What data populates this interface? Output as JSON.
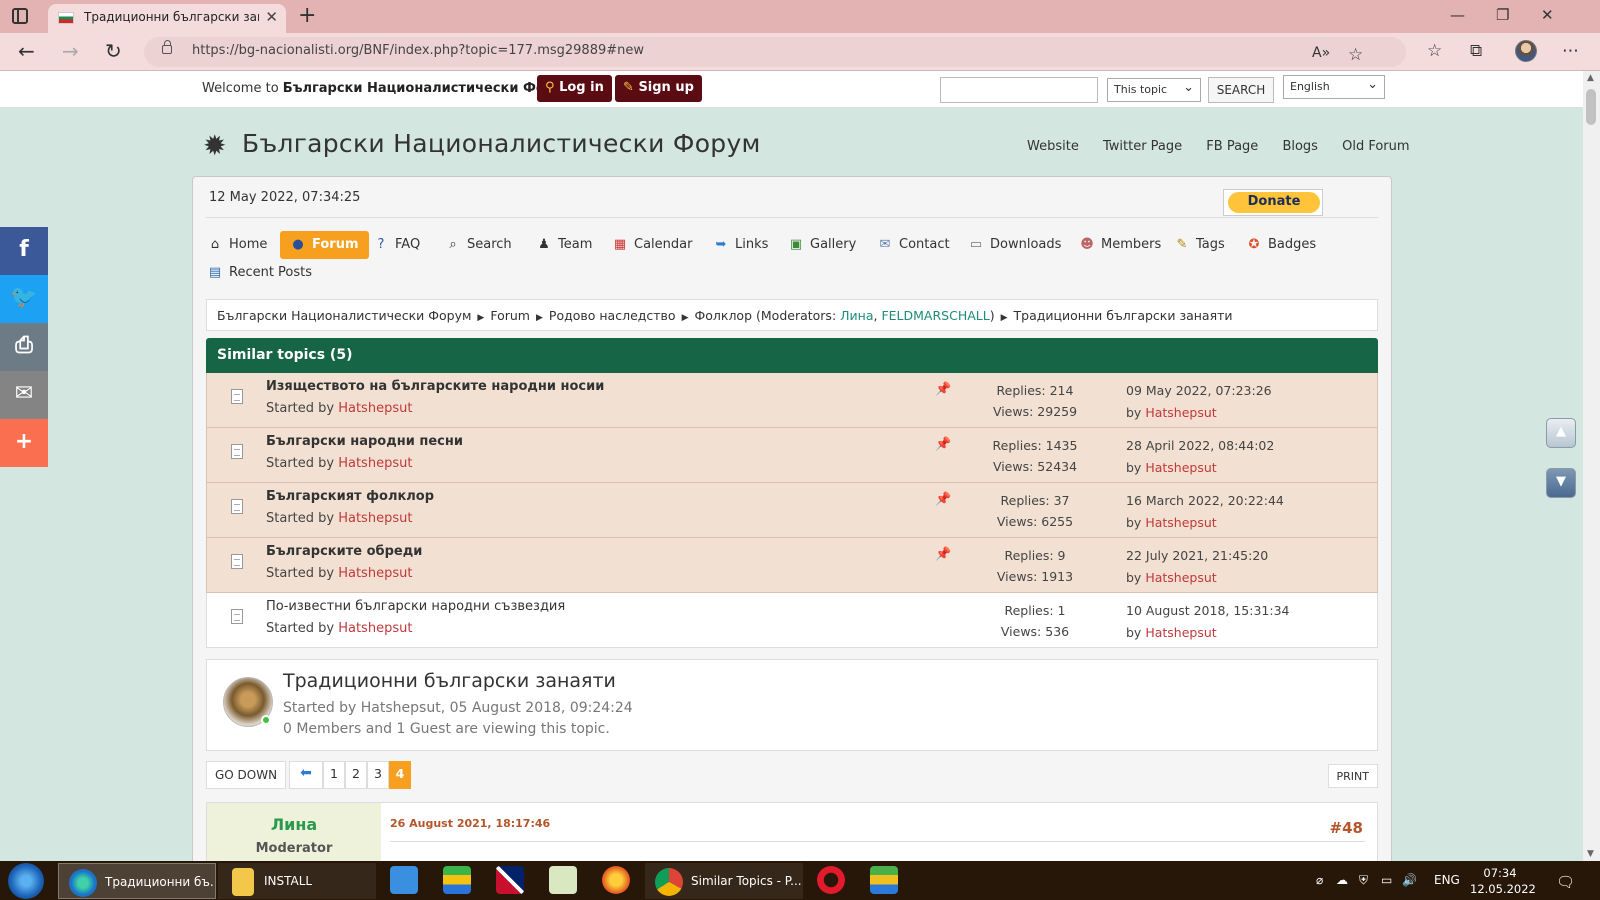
{
  "browser": {
    "tab_title": "Традиционни български занаяти",
    "url": "https://bg-nacionalisti.org/BNF/index.php?topic=177.msg29889#new"
  },
  "topbar": {
    "welcome_prefix": "Welcome to ",
    "welcome_site": "Български Националистически Форум",
    "welcome_suffix": ".",
    "login": "Log in",
    "signup": "Sign up",
    "search_scope": "This topic",
    "search_button": "SEARCH",
    "language": "English"
  },
  "header": {
    "title": "Български Националистически Форум",
    "links": [
      "Website",
      "Twitter Page",
      "FB Page",
      "Blogs",
      "Old Forum"
    ]
  },
  "datetime": "12 May 2022, 07:34:25",
  "donate": "Donate",
  "menu": {
    "home": "Home",
    "forum": "Forum",
    "faq": "FAQ",
    "search": "Search",
    "team": "Team",
    "calendar": "Calendar",
    "links": "Links",
    "gallery": "Gallery",
    "contact": "Contact",
    "downloads": "Downloads",
    "members": "Members",
    "tags": "Tags",
    "badges": "Badges",
    "recent_posts": "Recent Posts"
  },
  "breadcrumb": {
    "home": "Български Националистически Форум",
    "forum": "Forum",
    "category": "Родово наследство",
    "board": "Фолклор",
    "moderators_prefix": "(Moderators: ",
    "mod1": "Лина",
    "mod_sep": ", ",
    "mod2": "FELDMARSCHALL",
    "moderators_suffix": ")",
    "topic": "Традиционни български занаяти"
  },
  "similar": {
    "header": "Similar topics (5)",
    "started_by": "Started by ",
    "topics": [
      {
        "title": "Изяществото на българските народни носии",
        "starter": "Hatshepsut",
        "replies": "Replies: 214",
        "views": "Views: 29259",
        "last_date": "09 May 2022, 07:23:26",
        "last_by_prefix": "by ",
        "last_by": "Hatshepsut"
      },
      {
        "title": "Български народни песни",
        "starter": "Hatshepsut",
        "replies": "Replies: 1435",
        "views": "Views: 52434",
        "last_date": "28 April 2022, 08:44:02",
        "last_by_prefix": "by ",
        "last_by": "Hatshepsut"
      },
      {
        "title": "Българският фолклор",
        "starter": "Hatshepsut",
        "replies": "Replies: 37",
        "views": "Views: 6255",
        "last_date": "16 March 2022, 20:22:44",
        "last_by_prefix": "by ",
        "last_by": "Hatshepsut"
      },
      {
        "title": "Българските обреди",
        "starter": "Hatshepsut",
        "replies": "Replies: 9",
        "views": "Views: 1913",
        "last_date": "22 July 2021, 21:45:20",
        "last_by_prefix": "by ",
        "last_by": "Hatshepsut"
      },
      {
        "title": "По-известни български народни съзвездия",
        "starter": "Hatshepsut",
        "replies": "Replies: 1",
        "views": "Views: 536",
        "last_date": "10 August 2018, 15:31:34",
        "last_by_prefix": "by ",
        "last_by": "Hatshepsut"
      }
    ]
  },
  "topic": {
    "title": "Традиционни български занаяти",
    "meta": "Started by Hatshepsut, 05 August 2018, 09:24:24",
    "viewers": "0 Members and 1 Guest are viewing this topic."
  },
  "pagination": {
    "go_down": "GO DOWN",
    "pages": [
      "1",
      "2",
      "3",
      "4"
    ],
    "current": "4",
    "print": "PRINT"
  },
  "post": {
    "author": "Лина",
    "role": "Moderator",
    "date": "26 August 2021, 18:17:46",
    "number": "#48"
  },
  "social_colors": {
    "facebook": "#3b5998",
    "twitter": "#1da1f2",
    "print": "#6d7b86",
    "email": "#848484",
    "more": "#f96f50"
  },
  "taskbar": {
    "edge_label": "Традиционни бъ...",
    "install_label": "INSTALL",
    "chrome_label": "Similar Topics - P...",
    "lang": "ENG",
    "time": "07:34",
    "date": "12.05.2022 г."
  }
}
